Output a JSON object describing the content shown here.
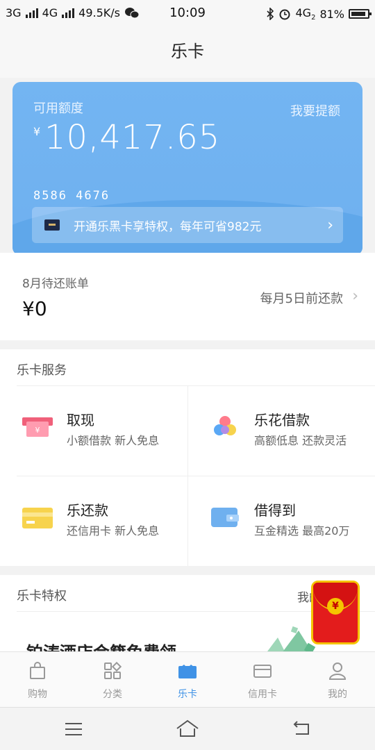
{
  "status": {
    "left": [
      "3G",
      "4G",
      "49.5K/s"
    ],
    "time": "10:09",
    "network2": "4G",
    "sim": "2",
    "battery": "81%"
  },
  "page": {
    "title": "乐卡"
  },
  "card": {
    "available_label": "可用额度",
    "raise_label": "我要提额",
    "currency": "¥",
    "amount": "10,417.65",
    "number": "8586 4676",
    "promo_text": "开通乐黑卡享特权，每年可省982元"
  },
  "bill": {
    "label": "8月待还账单",
    "amount": "¥0",
    "due_note": "每月5日前还款"
  },
  "services": {
    "title": "乐卡服务",
    "items": [
      {
        "title": "取现",
        "desc": "小额借款 新人免息",
        "icon": "cash-icon"
      },
      {
        "title": "乐花借款",
        "desc": "高额低息 还款灵活",
        "icon": "flower-icon"
      },
      {
        "title": "乐还款",
        "desc": "还信用卡 新人免息",
        "icon": "card-icon"
      },
      {
        "title": "借得到",
        "desc": "互金精选 最高20万",
        "icon": "wallet-icon"
      }
    ]
  },
  "perks": {
    "title": "乐卡特权",
    "right_label": "我的",
    "banner_text": "铂涛酒店会籍免费领"
  },
  "tabs": [
    {
      "label": "购物",
      "icon": "shopping-bag-icon",
      "active": false
    },
    {
      "label": "分类",
      "icon": "category-icon",
      "active": true
    },
    {
      "label": "乐卡",
      "icon": "lecard-icon",
      "active": true
    },
    {
      "label": "信用卡",
      "icon": "credit-card-icon",
      "active": false
    },
    {
      "label": "我的",
      "icon": "user-icon",
      "active": false
    }
  ],
  "colors": {
    "accent": "#3f92e6",
    "card": "#73b5f2"
  }
}
